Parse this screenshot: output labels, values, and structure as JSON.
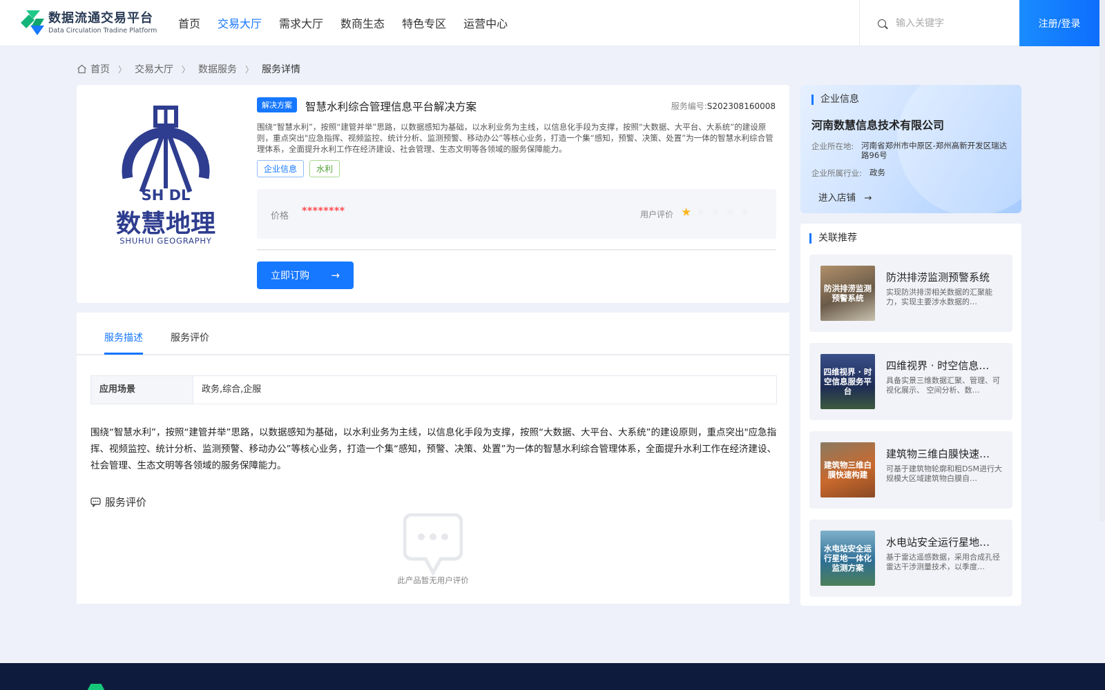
{
  "brand": {
    "name_cn": "数据流通交易平台",
    "name_en": "Data Circulation Tradine Platform",
    "accent": "#1677ff"
  },
  "nav": {
    "items": [
      "首页",
      "交易大厅",
      "需求大厅",
      "数商生态",
      "特色专区",
      "运营中心"
    ],
    "active": "交易大厅"
  },
  "search": {
    "placeholder": "输入关键字"
  },
  "login_label": "注册/登录",
  "breadcrumb": [
    "首页",
    "交易大厅",
    "数据服务",
    "服务详情"
  ],
  "product": {
    "logo_text_cn": "数慧地理",
    "logo_text_en": "SHUHUI GEOGRAPHY",
    "logo_letters": "SH DL",
    "badge": "解决方案",
    "title": "智慧水利综合管理信息平台解决方案",
    "service_no_label": "服务编号:",
    "service_no": "S202308160008",
    "summary": "围绕“智慧水利”，按照“建管并举”思路，以数据感知为基础，以水利业务为主线，以信息化手段为支撑，按照“大数据、大平台、大系统”的建设原则，重点突出\"应急指挥、视频监控、统计分析、监测预警、移动办公”等核心业务，打造一个集“感知，预警、决策、处置”为一体的智慧水利综合管理体系，全面提升水利工作在经济建设、社会管理、生态文明等各领域的服务保障能力。",
    "tags": [
      "企业信息",
      "水利"
    ],
    "price_label": "价格",
    "price": "********",
    "rating_label": "用户评价",
    "rating": 1,
    "rating_max": 5,
    "buy_label": "立即订购"
  },
  "tabs": [
    "服务描述",
    "服务评价"
  ],
  "scene": {
    "key": "应用场景",
    "value": "政务,综合,企服"
  },
  "description": "围绕“智慧水利”，按照“建管并举”思路，以数据感知为基础，以水利业务为主线，以信息化手段为支撑，按照“大数据、大平台、大系统”的建设原则，重点突出\"应急指挥、视频监控、统计分析、监测预警、移动办公”等核心业务，打造一个集“感知，预警、决策、处置”为一体的智慧水利综合管理体系，全面提升水利工作在经济建设、社会管理、生态文明等各领域的服务保障能力。",
  "reviews": {
    "title": "服务评价",
    "empty": "此产品暂无用户评价"
  },
  "company": {
    "section": "企业信息",
    "name": "河南数慧信息技术有限公司",
    "location_label": "企业所在地:",
    "location": "河南省郑州市中原区-郑州高新开发区瑞达路96号",
    "industry_label": "企业所属行业:",
    "industry": "政务",
    "enter_label": "进入店铺"
  },
  "related": {
    "section": "关联推荐",
    "items": [
      {
        "title": "防洪排涝监测预警系统",
        "desc": "实现防洪排涝相关数据的汇聚能力，实现主要涉水数据的…",
        "thumb_text": "防洪排涝监测预警系统",
        "thumb_color": "#8a6a4a"
      },
      {
        "title": "四维视界 · 时空信息…",
        "desc": "具备实景三维数据汇聚、管理、可视化展示、 空间分析、数…",
        "thumb_text": "四维视界 · 时空信息服务平台",
        "thumb_color": "#2b3f73"
      },
      {
        "title": "建筑物三维白膜快速…",
        "desc": "可基于建筑物轮廓和粗DSM进行大规模大区域建筑物白膜自…",
        "thumb_text": "建筑物三维白膜快速构建",
        "thumb_color": "#b5652f"
      },
      {
        "title": "水电站安全运行星地…",
        "desc": "基于雷达遥感数据，采用合成孔径雷达干涉测量技术，以季度…",
        "thumb_text": "水电站安全运行星地一体化监测方案",
        "thumb_color": "#3a7fa8"
      }
    ]
  }
}
